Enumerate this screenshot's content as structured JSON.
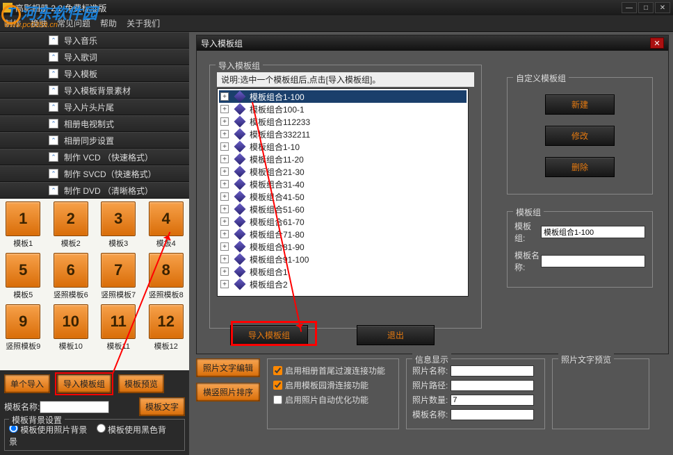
{
  "title": "高影相册 2.2 免费标准版",
  "watermark_text": "河东软件园",
  "watermark_url": "www.pc0359.cn",
  "menu": [
    "制作",
    "换肤",
    "常见问题",
    "帮助",
    "关于我们"
  ],
  "sidebar": {
    "items": [
      "导入音乐",
      "导入歌词",
      "导入模板",
      "导入模板背景素材",
      "导入片头片尾",
      "相册电视制式",
      "相册同步设置",
      "制作 VCD （快速格式）",
      "制作 SVCD（快速格式）",
      "制作 DVD （清晰格式）"
    ]
  },
  "templates": [
    {
      "n": "1",
      "label": "模板1"
    },
    {
      "n": "2",
      "label": "模板2"
    },
    {
      "n": "3",
      "label": "模板3"
    },
    {
      "n": "4",
      "label": "模板4"
    },
    {
      "n": "5",
      "label": "模板5"
    },
    {
      "n": "6",
      "label": "竖照模板6"
    },
    {
      "n": "7",
      "label": "竖照模板7"
    },
    {
      "n": "8",
      "label": "竖照模板8"
    },
    {
      "n": "9",
      "label": "竖照模板9"
    },
    {
      "n": "10",
      "label": "模板10"
    },
    {
      "n": "11",
      "label": "模板11"
    },
    {
      "n": "12",
      "label": "模板12"
    }
  ],
  "sidebtns": {
    "single_import": "单个导入",
    "group_import": "导入模板组",
    "preview": "模板预览",
    "text": "模板文字",
    "name_label": "模板名称:",
    "bg_legend": "模板背景设置",
    "radio_photo": "模板使用照片背景",
    "radio_black": "模板使用黑色背景"
  },
  "dialog": {
    "title": "导入模板组",
    "group_legend": "导入模板组",
    "hint_prefix": "说明:",
    "hint": "选中一个模板组后,点击[导入模板组]。",
    "tree": [
      "模板组合1-100",
      "模板组合100-1",
      "模板组合112233",
      "模板组合332211",
      "模板组合1-10",
      "模板组合11-20",
      "模板组合21-30",
      "模板组合31-40",
      "模板组合41-50",
      "模板组合51-60",
      "模板组合61-70",
      "模板组合71-80",
      "模板组合81-90",
      "模板组合91-100",
      "模板组合1",
      "模板组合2"
    ],
    "custom_legend": "自定义模板组",
    "btn_new": "新建",
    "btn_edit": "修改",
    "btn_delete": "删除",
    "info_legend": "模板组",
    "info_group_label": "模板组:",
    "info_group_value": "模板组合1-100",
    "info_name_label": "模板名称:",
    "btn_import": "导入模板组",
    "btn_exit": "退出"
  },
  "lower": {
    "edit_text_btn": "照片文字编辑",
    "sort_btn": "横竖照片排序",
    "chk1": "启用相册首尾过渡连接功能",
    "chk2": "启用模板园滑连接功能",
    "chk3": "启用照片自动优化功能",
    "info_legend": "信息显示",
    "photo_name": "照片名称:",
    "photo_path": "照片路径:",
    "photo_count": "照片数量:",
    "photo_count_val": "7",
    "tpl_name": "模板名称:",
    "preview_legend": "照片文字预览"
  }
}
